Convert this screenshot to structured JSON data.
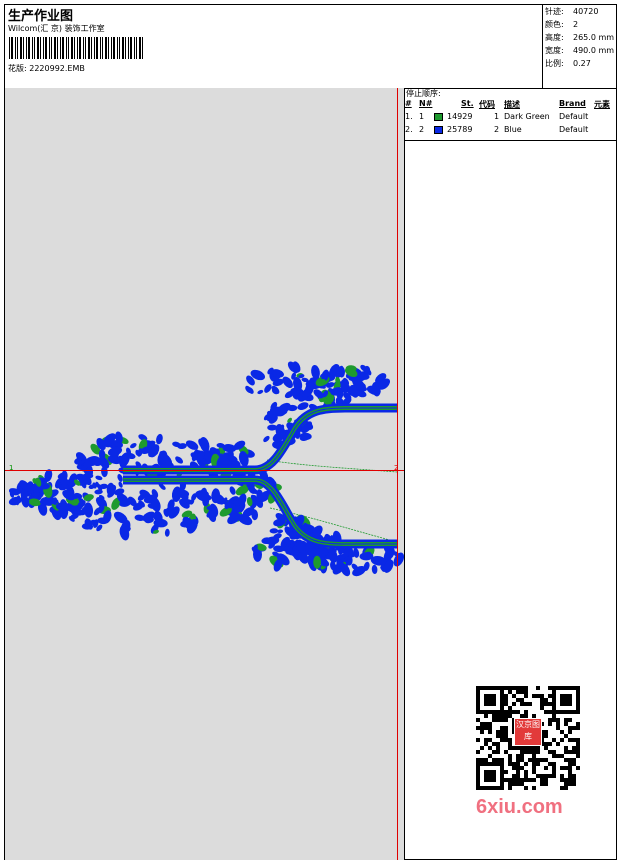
{
  "header": {
    "title": "生产作业图",
    "company": "Wilcom(汇 京) 装饰工作室",
    "design_label": "花版:",
    "design_file": "2220992.EMB"
  },
  "stats": [
    {
      "label": "针迹:",
      "value": "40720"
    },
    {
      "label": "颜色:",
      "value": "2"
    },
    {
      "label": "高度:",
      "value": "265.0 mm"
    },
    {
      "label": "宽度:",
      "value": "490.0 mm"
    },
    {
      "label": "比例:",
      "value": "0.27"
    }
  ],
  "stop_sequence": {
    "title": "停止顺序:",
    "columns": [
      "#",
      "N#",
      "St.",
      "代码",
      "描述",
      "Brand",
      "元素"
    ],
    "rows": [
      {
        "index": "1.",
        "n": "1",
        "color": "#1e9a2e",
        "stitches": "14929",
        "code": "1",
        "desc": "Dark Green",
        "brand": "Default"
      },
      {
        "index": "2.",
        "n": "2",
        "color": "#0a28e6",
        "stitches": "25789",
        "code": "2",
        "desc": "Blue",
        "brand": "Default"
      }
    ]
  },
  "canvas": {
    "background": "#dcdcdc",
    "guide_color": "#e00000",
    "marker_left": "1",
    "marker_right": "2"
  },
  "embroidery_colors": {
    "blue": "#0a28e6",
    "green": "#1e9a2e"
  },
  "watermark": "6xiu.com",
  "qr_badge": "汉京图库"
}
